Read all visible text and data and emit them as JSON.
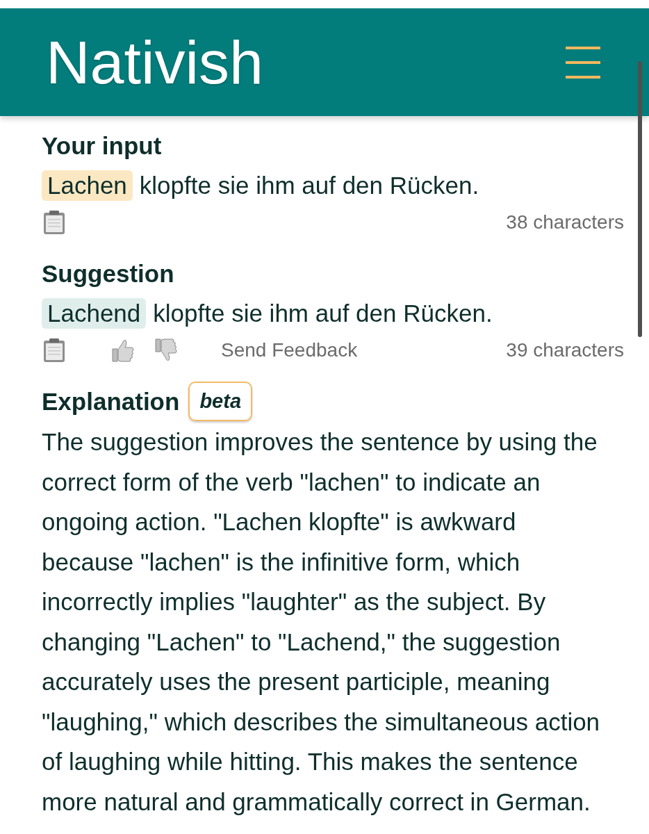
{
  "header": {
    "logo": "Nativish"
  },
  "input": {
    "heading": "Your input",
    "sentence": [
      {
        "text": "Lachen",
        "highlighted": true
      },
      {
        "text": "klopfte sie ihm auf den Rücken.",
        "highlighted": false
      }
    ],
    "char_count": "38 characters"
  },
  "suggestion": {
    "heading": "Suggestion",
    "sentence": [
      {
        "text": "Lachend",
        "highlighted": true
      },
      {
        "text": "klopfte sie ihm auf den Rücken.",
        "highlighted": false
      }
    ],
    "feedback_link": "Send Feedback",
    "char_count": "39 characters"
  },
  "explanation": {
    "heading": "Explanation",
    "badge": "beta",
    "text": "The suggestion improves the sentence by using the correct form of the verb \"lachen\" to indicate an ongoing action. \"Lachen klopfte\" is awkward because \"lachen\" is the infinitive form, which incorrectly implies \"laughter\" as the subject. By changing \"Lachen\" to \"Lachend,\" the suggestion accurately uses the present participle, meaning \"laughing,\" which describes the simultaneous action of laughing while hitting. This makes the sentence more natural and grammatically correct in German."
  }
}
